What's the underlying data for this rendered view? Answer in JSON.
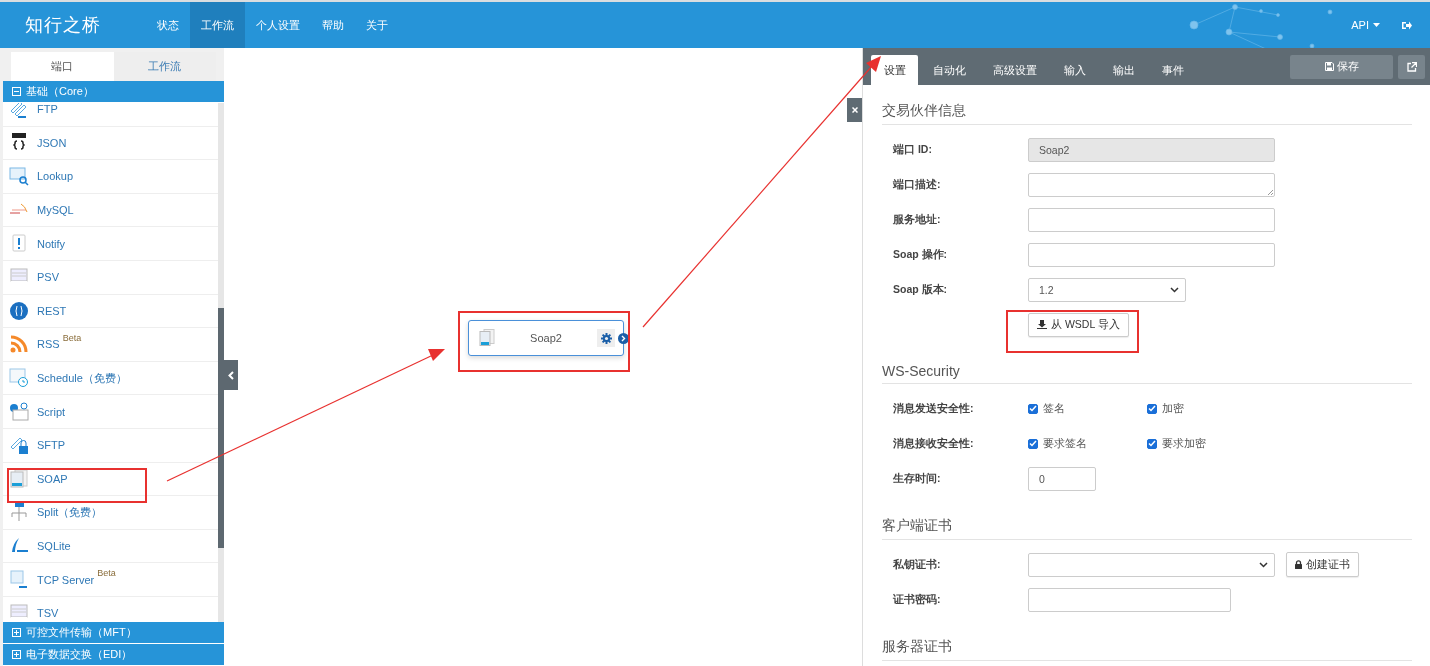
{
  "header": {
    "logo": "知行之桥",
    "nav": [
      {
        "label": "状态",
        "selected": false
      },
      {
        "label": "工作流",
        "selected": true
      },
      {
        "label": "个人设置",
        "selected": false
      },
      {
        "label": "帮助",
        "selected": false
      },
      {
        "label": "关于",
        "selected": false
      }
    ],
    "user_menu": "API"
  },
  "sidebar": {
    "tabs": [
      {
        "label": "端口",
        "selected": true
      },
      {
        "label": "工作流",
        "selected": false
      }
    ],
    "groups": [
      {
        "label": "基础（Core）",
        "expanded": true,
        "items": [
          {
            "label": "FTP"
          },
          {
            "label": "JSON"
          },
          {
            "label": "Lookup"
          },
          {
            "label": "MySQL"
          },
          {
            "label": "Notify"
          },
          {
            "label": "PSV"
          },
          {
            "label": "REST"
          },
          {
            "label": "RSS",
            "badge": "Beta"
          },
          {
            "label": "Schedule（免费）"
          },
          {
            "label": "Script"
          },
          {
            "label": "SFTP"
          },
          {
            "label": "SOAP"
          },
          {
            "label": "Split（免费）"
          },
          {
            "label": "SQLite"
          },
          {
            "label": "TCP Server",
            "badge": "Beta"
          },
          {
            "label": "TSV"
          }
        ]
      },
      {
        "label": "可控文件传输（MFT）",
        "expanded": false
      },
      {
        "label": "电子数据交换（EDI）",
        "expanded": false
      }
    ]
  },
  "canvas": {
    "node": {
      "label": "Soap2"
    }
  },
  "panel": {
    "tabs": [
      {
        "label": "设置",
        "selected": true
      },
      {
        "label": "自动化",
        "selected": false
      },
      {
        "label": "高级设置",
        "selected": false
      },
      {
        "label": "输入",
        "selected": false
      },
      {
        "label": "输出",
        "selected": false
      },
      {
        "label": "事件",
        "selected": false
      }
    ],
    "save_button": "保存",
    "sections": [
      {
        "title": "交易伙伴信息",
        "rows": [
          {
            "kind": "text",
            "label": "端口 ID:",
            "value": "Soap2",
            "disabled": true
          },
          {
            "kind": "textarea",
            "label": "端口描述:",
            "disabled": false
          },
          {
            "kind": "text",
            "label": "服务地址:",
            "disabled": false
          },
          {
            "kind": "text",
            "label": "Soap 操作:",
            "disabled": false
          },
          {
            "kind": "select",
            "label": "Soap 版本:",
            "value": "1.2",
            "disabled": false
          },
          {
            "kind": "button",
            "label": "从 WSDL 导入"
          }
        ]
      },
      {
        "title": "WS-Security",
        "rows": [
          {
            "kind": "checks",
            "label": "消息发送安全性:",
            "options": [
              {
                "label": "签名",
                "checked": true
              },
              {
                "label": "加密",
                "checked": true
              }
            ]
          },
          {
            "kind": "checks",
            "label": "消息接收安全性:",
            "options": [
              {
                "label": "要求签名",
                "checked": true
              },
              {
                "label": "要求加密",
                "checked": true
              }
            ]
          },
          {
            "kind": "number",
            "label": "生存时间:",
            "value": "0",
            "disabled": false
          }
        ]
      },
      {
        "title": "客户端证书",
        "rows": [
          {
            "kind": "select",
            "label": "私钥证书:",
            "action": "创建证书",
            "disabled": false
          },
          {
            "kind": "password",
            "label": "证书密码:",
            "disabled": false
          }
        ]
      },
      {
        "title": "服务器证书"
      }
    ]
  }
}
